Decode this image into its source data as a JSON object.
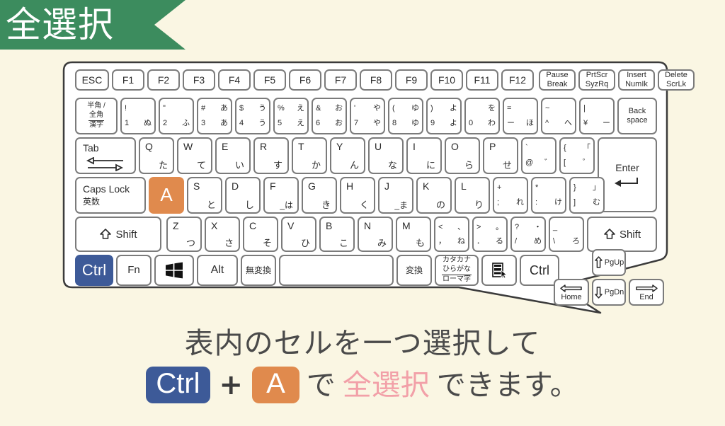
{
  "banner": {
    "label": "全選択",
    "color": "#3c8c5e",
    "text_color": "#ffffff"
  },
  "background_color": "#faf6e3",
  "caption": {
    "line1": "表内のセルを一つ選択して",
    "chip_ctrl": "Ctrl",
    "plus": "+",
    "chip_a": "A",
    "tail_before": "で",
    "highlight": "全選択",
    "tail_after": "できます。",
    "highlight_color": "#f2a0a8",
    "ctrl_color": "#3d5a98",
    "a_color": "#e08a4d"
  },
  "keyboard": {
    "highlight_orange": "#e08a4d",
    "highlight_blue": "#3d5a98",
    "row_function": [
      {
        "label": "ESC"
      },
      {
        "label": "F1"
      },
      {
        "label": "F2"
      },
      {
        "label": "F3"
      },
      {
        "label": "F4"
      },
      {
        "label": "F5"
      },
      {
        "label": "F6"
      },
      {
        "label": "F7"
      },
      {
        "label": "F8"
      },
      {
        "label": "F9"
      },
      {
        "label": "F10"
      },
      {
        "label": "F11"
      },
      {
        "label": "F12"
      },
      {
        "top": "Pause",
        "bottom": "Break"
      },
      {
        "top": "PrtScr",
        "bottom": "SyzRq"
      },
      {
        "top": "Insert",
        "bottom": "NumIk"
      },
      {
        "top": "Delete",
        "bottom": "ScrLk"
      }
    ],
    "row_number": [
      {
        "l1": "半角 /",
        "l2": "全角",
        "l3": "漢字"
      },
      {
        "tl": "!",
        "tr": "",
        "bl": "1",
        "br": "ぬ"
      },
      {
        "tl": "\"",
        "tr": "",
        "bl": "2",
        "br": "ふ"
      },
      {
        "tl": "#",
        "tr": "あ",
        "bl": "3",
        "br": "あ"
      },
      {
        "tl": "$",
        "tr": "う",
        "bl": "4",
        "br": "う"
      },
      {
        "tl": "%",
        "tr": "え",
        "bl": "5",
        "br": "え"
      },
      {
        "tl": "&",
        "tr": "お",
        "bl": "6",
        "br": "お"
      },
      {
        "tl": "'",
        "tr": "や",
        "bl": "7",
        "br": "や"
      },
      {
        "tl": "(",
        "tr": "ゆ",
        "bl": "8",
        "br": "ゆ"
      },
      {
        "tl": ")",
        "tr": "よ",
        "bl": "9",
        "br": "よ"
      },
      {
        "tl": "",
        "tr": "を",
        "bl": "0",
        "br": "わ"
      },
      {
        "tl": "=",
        "tr": "",
        "bl": "ー",
        "br": "ほ"
      },
      {
        "tl": "~",
        "tr": "",
        "bl": "^",
        "br": "へ"
      },
      {
        "tl": "|",
        "tr": "",
        "bl": "¥",
        "br": "ー"
      },
      {
        "top": "Back",
        "bottom": "space"
      }
    ],
    "row_qwerty": [
      {
        "label": "Tab"
      },
      {
        "letter": "Q",
        "kana": "た"
      },
      {
        "letter": "W",
        "kana": "て"
      },
      {
        "letter": "E",
        "kana": "い"
      },
      {
        "letter": "R",
        "kana": "す"
      },
      {
        "letter": "T",
        "kana": "か"
      },
      {
        "letter": "Y",
        "kana": "ん"
      },
      {
        "letter": "U",
        "kana": "な"
      },
      {
        "letter": "I",
        "kana": "に"
      },
      {
        "letter": "O",
        "kana": "ら"
      },
      {
        "letter": "P",
        "kana": "せ"
      },
      {
        "tl": "`",
        "tr": "",
        "bl": "@",
        "br": "゛"
      },
      {
        "tl": "{",
        "tr": "「",
        "bl": "[",
        "br": "゜"
      },
      {
        "label": "Enter"
      }
    ],
    "row_home": [
      {
        "label": "Caps Lock",
        "sub": "英数"
      },
      {
        "letter": "A",
        "kana": "",
        "highlight": "orange"
      },
      {
        "letter": "S",
        "kana": "と"
      },
      {
        "letter": "D",
        "kana": "し"
      },
      {
        "letter": "F",
        "kana": "_は"
      },
      {
        "letter": "G",
        "kana": "き"
      },
      {
        "letter": "H",
        "kana": "く"
      },
      {
        "letter": "J",
        "kana": "_ま"
      },
      {
        "letter": "K",
        "kana": "の"
      },
      {
        "letter": "L",
        "kana": "り"
      },
      {
        "tl": "+",
        "tr": "",
        "bl": ";",
        "br": "れ"
      },
      {
        "tl": "*",
        "tr": "",
        "bl": ":",
        "br": "け"
      },
      {
        "tl": "}",
        "tr": "」",
        "bl": "]",
        "br": "む"
      }
    ],
    "row_shift": [
      {
        "label": "Shift",
        "icon": "shift-arrow-icon"
      },
      {
        "letter": "Z",
        "kana": "つ"
      },
      {
        "letter": "X",
        "kana": "さ"
      },
      {
        "letter": "C",
        "kana": "そ"
      },
      {
        "letter": "V",
        "kana": "ひ"
      },
      {
        "letter": "B",
        "kana": "こ"
      },
      {
        "letter": "N",
        "kana": "み"
      },
      {
        "letter": "M",
        "kana": "も"
      },
      {
        "tl": "<",
        "tr": "、",
        "bl": "，",
        "br": "ね"
      },
      {
        "tl": ">",
        "tr": "。",
        "bl": "．",
        "br": "る"
      },
      {
        "tl": "?",
        "tr": "・",
        "bl": "/",
        "br": "め"
      },
      {
        "tl": "_",
        "tr": "",
        "bl": "\\",
        "br": "ろ"
      },
      {
        "label": "Shift",
        "icon": "shift-arrow-icon"
      }
    ],
    "row_bottom": [
      {
        "label": "Ctrl",
        "highlight": "blue"
      },
      {
        "label": "Fn"
      },
      {
        "label": "",
        "icon": "windows-icon"
      },
      {
        "label": "Alt"
      },
      {
        "label": "無変換"
      },
      {
        "label": "",
        "name": "space-bar"
      },
      {
        "label": "変換"
      },
      {
        "l1": "カタカナ",
        "l2": "ひらがな",
        "l3": "ローマ字"
      },
      {
        "label": "",
        "icon": "context-menu-icon"
      },
      {
        "label": "Ctrl"
      }
    ],
    "nav_cluster": [
      {
        "label": "PgUp",
        "icon": "arrow-up-icon"
      },
      {
        "label": "Home",
        "icon": "arrow-left-icon"
      },
      {
        "label": "PgDn",
        "icon": "arrow-down-icon"
      },
      {
        "label": "End",
        "icon": "arrow-right-icon"
      }
    ]
  }
}
